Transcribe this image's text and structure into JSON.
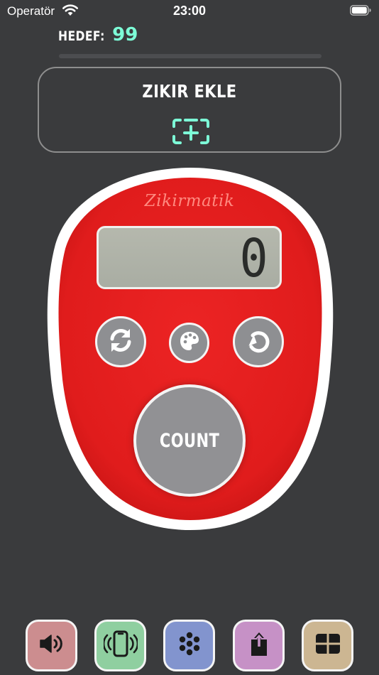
{
  "status_bar": {
    "carrier": "Operatör",
    "time": "23:00",
    "wifi_icon": "wifi-icon",
    "battery_icon": "battery-full-icon"
  },
  "target": {
    "label": "HEDEF:",
    "value": "99",
    "progress": 0,
    "value_color": "#7dffd8"
  },
  "add_dhikr": {
    "title": "ZIKIR EKLE",
    "icon": "add-square-icon"
  },
  "counter": {
    "brand": "Zikirmatik",
    "display_value": "0",
    "body_color": "#e41f1f",
    "reset_icon": "sync-icon",
    "theme_icon": "palette-icon",
    "undo_icon": "undo-icon",
    "count_label": "COUNT"
  },
  "toolbar": {
    "buttons": [
      {
        "icon": "speaker-icon",
        "color": "#cc8d8f"
      },
      {
        "icon": "vibration-icon",
        "color": "#8fcfa0"
      },
      {
        "icon": "beads-icon",
        "color": "#8294ce"
      },
      {
        "icon": "share-icon",
        "color": "#c691c6"
      },
      {
        "icon": "grid-icon",
        "color": "#ccb692"
      }
    ]
  }
}
